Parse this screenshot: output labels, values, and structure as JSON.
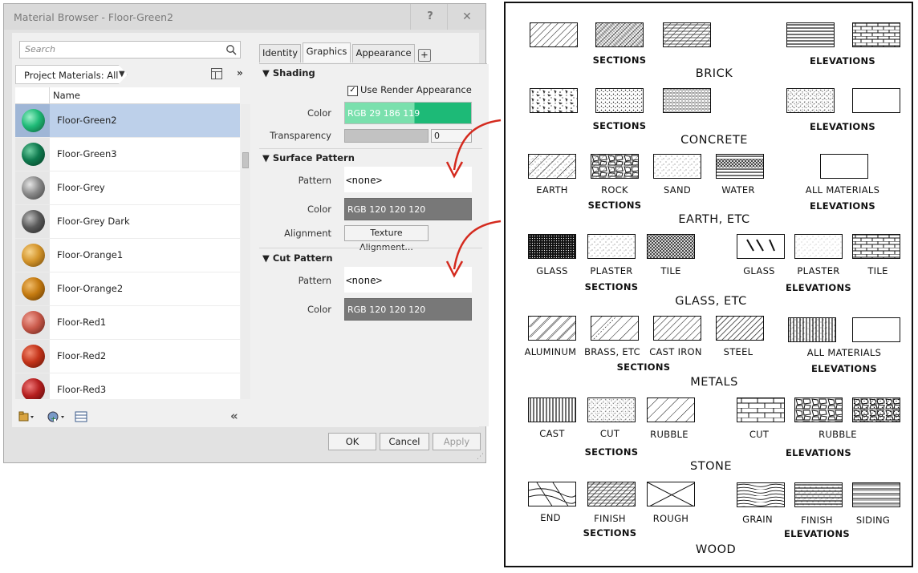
{
  "dialog": {
    "title": "Material Browser - Floor-Green2",
    "help_label": "?",
    "close_label": "✕",
    "search_placeholder": "Search",
    "library_label": "Project Materials: All",
    "more_label": "»",
    "column_name": "Name",
    "materials": [
      {
        "name": "Floor-Green2",
        "color": "#1fba77",
        "selected": true
      },
      {
        "name": "Floor-Green3",
        "color": "#0f7a4e"
      },
      {
        "name": "Floor-Grey",
        "color": "#8a8a8a"
      },
      {
        "name": "Floor-Grey Dark",
        "color": "#5a5a5a"
      },
      {
        "name": "Floor-Orange1",
        "color": "#d4952b"
      },
      {
        "name": "Floor-Orange2",
        "color": "#c47a10"
      },
      {
        "name": "Floor-Red1",
        "color": "#c9594a"
      },
      {
        "name": "Floor-Red2",
        "color": "#c4341a"
      },
      {
        "name": "Floor-Red3",
        "color": "#b51f1f"
      }
    ],
    "collapse_label": "«",
    "tabs": [
      "Identity",
      "Graphics",
      "Appearance"
    ],
    "active_tab": "Graphics",
    "tab_add": "+",
    "shading": {
      "header": "Shading",
      "use_render_label": "Use Render Appearance",
      "use_render_checked": true,
      "color_label": "Color",
      "color_value": "RGB 29 186 119",
      "color_hex": "#1dba77",
      "transparency_label": "Transparency",
      "transparency_value": "0"
    },
    "surface_pattern": {
      "header": "Surface Pattern",
      "pattern_label": "Pattern",
      "pattern_value": "<none>",
      "color_label": "Color",
      "color_value": "RGB 120 120 120",
      "color_hex": "#787878",
      "alignment_label": "Alignment",
      "alignment_button": "Texture Alignment..."
    },
    "cut_pattern": {
      "header": "Cut Pattern",
      "pattern_label": "Pattern",
      "pattern_value": "<none>",
      "color_label": "Color",
      "color_value": "RGB 120 120 120",
      "color_hex": "#787878"
    },
    "buttons": {
      "ok": "OK",
      "cancel": "Cancel",
      "apply": "Apply"
    }
  },
  "sheet": {
    "brick": {
      "title": "BRICK",
      "sections": "SECTIONS",
      "elevations": "ELEVATIONS"
    },
    "concrete": {
      "title": "CONCRETE",
      "sections": "SECTIONS",
      "elevations": "ELEVATIONS"
    },
    "earth": {
      "title": "EARTH, ETC",
      "labels": [
        "EARTH",
        "ROCK",
        "SAND",
        "WATER",
        "ALL MATERIALS"
      ],
      "sections": "SECTIONS",
      "elevations": "ELEVATIONS"
    },
    "glass": {
      "title": "GLASS, ETC",
      "section_labels": [
        "GLASS",
        "PLASTER",
        "TILE"
      ],
      "elevation_labels": [
        "GLASS",
        "PLASTER",
        "TILE"
      ],
      "sections": "SECTIONS",
      "elevations": "ELEVATIONS"
    },
    "metals": {
      "title": "METALS",
      "labels": [
        "ALUMINUM",
        "BRASS, ETC",
        "CAST IRON",
        "STEEL",
        "ALL MATERIALS"
      ],
      "sections": "SECTIONS",
      "elevations": "ELEVATIONS"
    },
    "stone": {
      "title": "STONE",
      "section_labels": [
        "CAST",
        "CUT",
        "RUBBLE"
      ],
      "elevation_labels": [
        "CUT",
        "RUBBLE"
      ],
      "sections": "SECTIONS",
      "elevations": "ELEVATIONS"
    },
    "wood": {
      "title": "WOOD",
      "section_labels": [
        "END",
        "FINISH",
        "ROUGH"
      ],
      "elevation_labels": [
        "GRAIN",
        "FINISH",
        "SIDING"
      ],
      "sections": "SECTIONS",
      "elevations": "ELEVATIONS"
    }
  }
}
